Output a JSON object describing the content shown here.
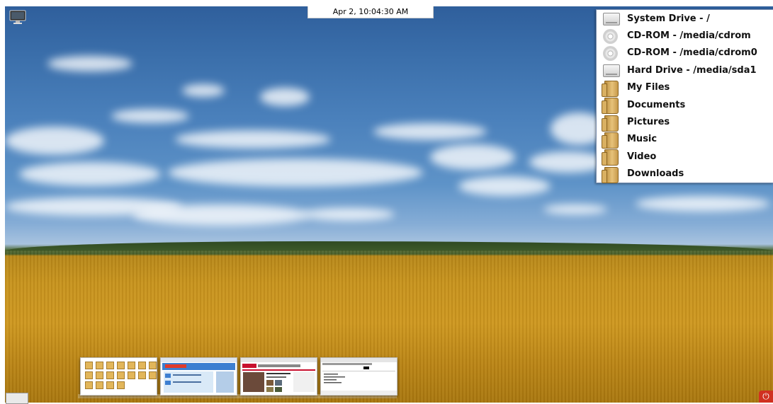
{
  "clock": {
    "text": "Apr  2, 10:04:30 AM"
  },
  "places_menu": {
    "items": [
      {
        "label": "System Drive - /",
        "icon": "hard-drive-icon"
      },
      {
        "label": "CD-ROM - /media/cdrom",
        "icon": "cd-icon"
      },
      {
        "label": "CD-ROM - /media/cdrom0",
        "icon": "cd-icon"
      },
      {
        "label": "Hard Drive - /media/sda1",
        "icon": "hard-drive-icon"
      },
      {
        "label": "My Files",
        "icon": "folder-icon"
      },
      {
        "label": "Documents",
        "icon": "folder-icon"
      },
      {
        "label": "Pictures",
        "icon": "folder-icon"
      },
      {
        "label": "Music",
        "icon": "folder-icon"
      },
      {
        "label": "Video",
        "icon": "folder-icon"
      },
      {
        "label": "Downloads",
        "icon": "folder-icon"
      }
    ]
  },
  "dock": {
    "windows": [
      {
        "name": "file-manager-window"
      },
      {
        "name": "browser-window-blue"
      },
      {
        "name": "browser-window-news"
      },
      {
        "name": "text-editor-window"
      }
    ]
  },
  "icons": {
    "top_left": "monitor-icon",
    "bottom_left": "window-switcher-icon",
    "bottom_right": "power-icon"
  },
  "colors": {
    "menu_border": "#7a8fb0",
    "power": "#d03020"
  }
}
